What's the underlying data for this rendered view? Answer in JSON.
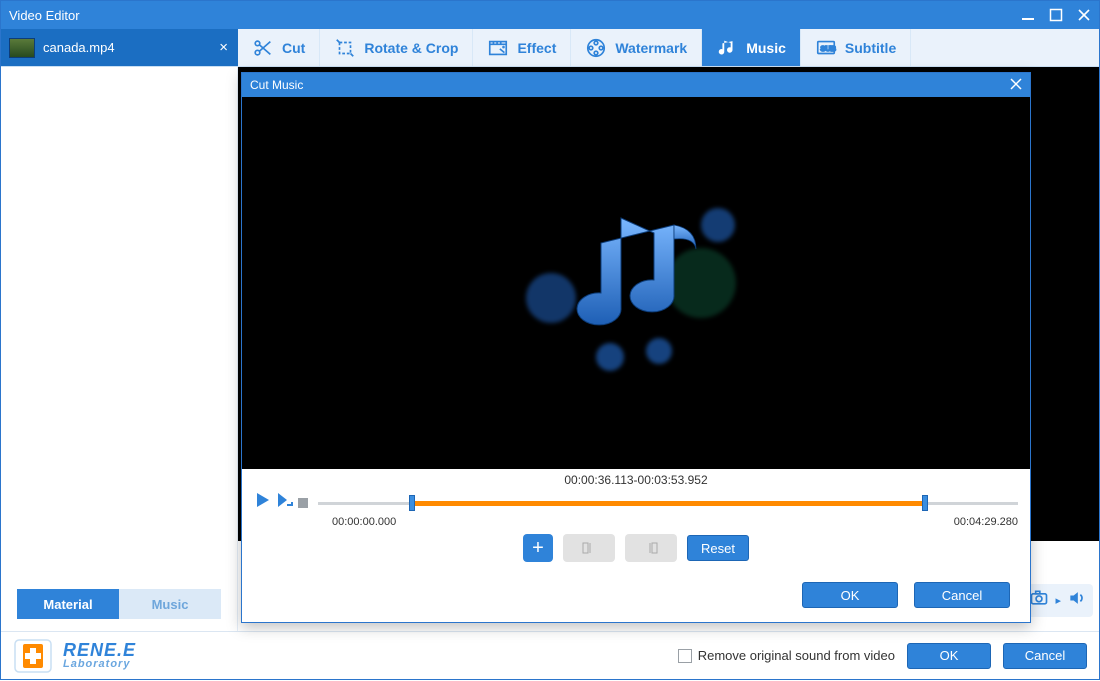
{
  "window": {
    "title": "Video Editor"
  },
  "file_tab": {
    "name": "canada.mp4"
  },
  "tools": {
    "cut": "Cut",
    "rotate": "Rotate & Crop",
    "effect": "Effect",
    "watermark": "Watermark",
    "music": "Music",
    "subtitle": "Subtitle",
    "active": "music"
  },
  "sidebar_tabs": {
    "material": "Material",
    "music": "Music",
    "active": "material"
  },
  "dialog": {
    "title": "Cut Music",
    "range_label": "00:00:36.113-00:03:53.952",
    "time_start": "00:00:00.000",
    "time_end": "00:04:29.280",
    "selection": {
      "start_pct": 13.4,
      "end_pct": 86.7
    },
    "reset": "Reset",
    "ok": "OK",
    "cancel": "Cancel"
  },
  "footer": {
    "brand_line1": "RENE.E",
    "brand_line2": "Laboratory",
    "checkbox_label": "Remove original sound from video",
    "ok": "OK",
    "cancel": "Cancel"
  }
}
